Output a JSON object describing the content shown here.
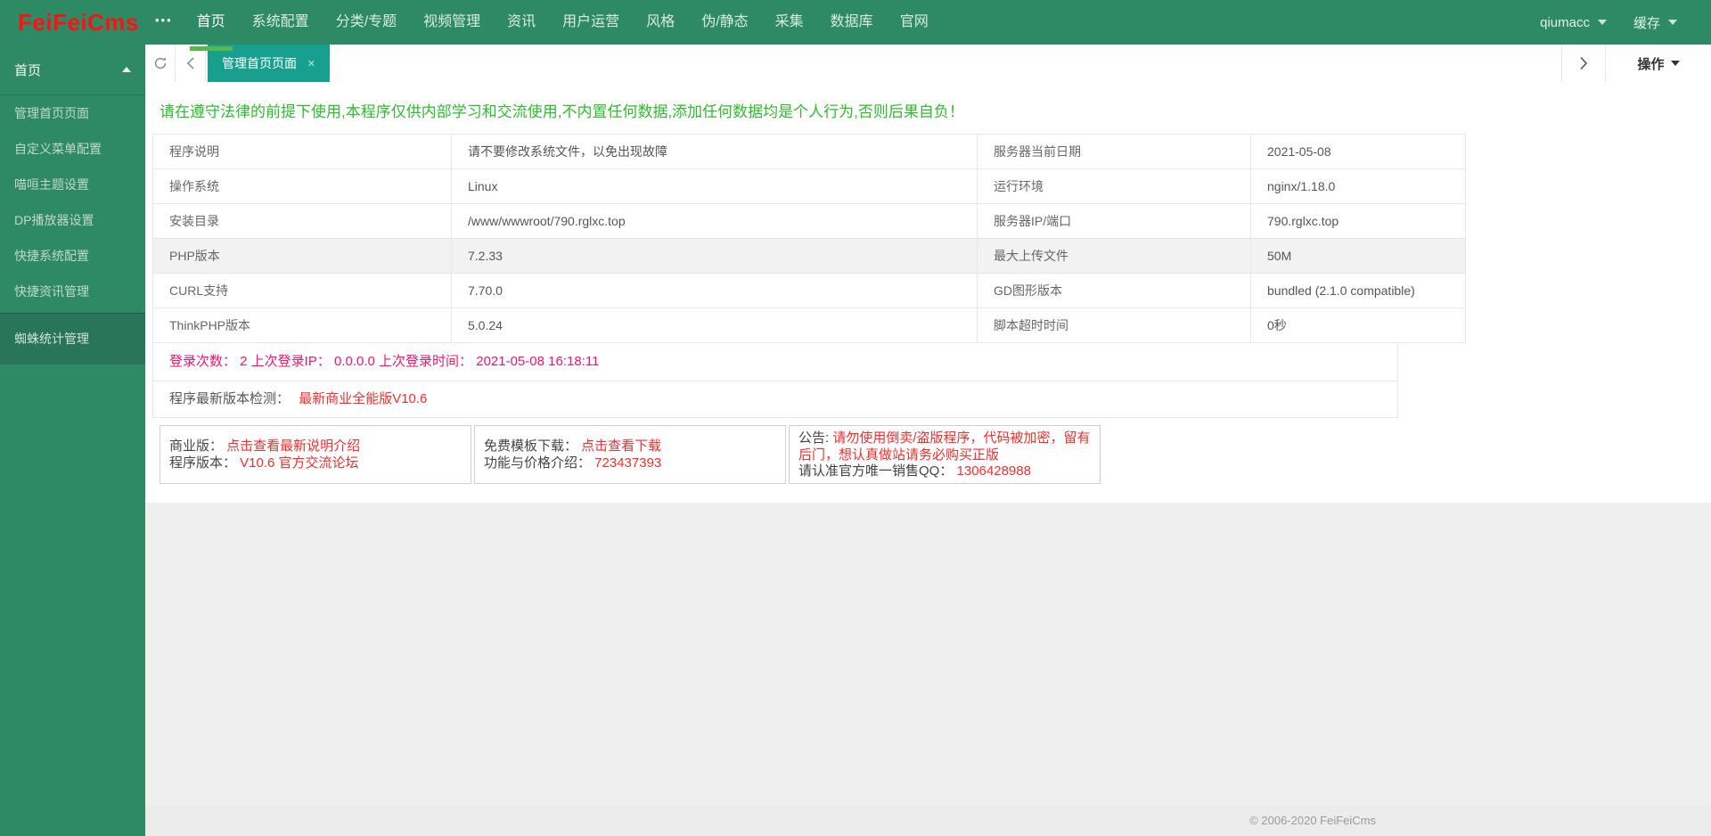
{
  "brand": {
    "logo": "FeiFeiCms",
    "more_icon": "•••"
  },
  "topnav": {
    "items": [
      {
        "id": "home",
        "label": "首页",
        "active": true
      },
      {
        "id": "system-config",
        "label": "系统配置"
      },
      {
        "id": "category-topic",
        "label": "分类/专题"
      },
      {
        "id": "video-management",
        "label": "视频管理"
      },
      {
        "id": "news",
        "label": "资讯"
      },
      {
        "id": "user-operation",
        "label": "用户运营"
      },
      {
        "id": "style",
        "label": "风格"
      },
      {
        "id": "pseudo-static",
        "label": "伪/静态"
      },
      {
        "id": "collect",
        "label": "采集"
      },
      {
        "id": "database",
        "label": "数据库"
      },
      {
        "id": "official-site",
        "label": "官网"
      }
    ],
    "user": "qiumacc",
    "cache": "缓存"
  },
  "sidebar": {
    "group_title": "首页",
    "items": [
      {
        "id": "manage-homepage",
        "label": "管理首页页面"
      },
      {
        "id": "custom-menu-config",
        "label": "自定义菜单配置"
      },
      {
        "id": "miaoxuan-theme-settings",
        "label": "喵咺主题设置"
      },
      {
        "id": "dp-player-settings",
        "label": "DP播放器设置"
      },
      {
        "id": "quick-system-config",
        "label": "快捷系统配置"
      },
      {
        "id": "quick-news-management",
        "label": "快捷资讯管理"
      }
    ],
    "bottom_group": "蜘蛛统计管理"
  },
  "tabbar": {
    "active_tab": "管理首页页面",
    "close": "×",
    "action_label": "操作"
  },
  "main": {
    "warning": "请在遵守法律的前提下使用,本程序仅供内部学习和交流使用,不内置任何数据,添加任何数据均是个人行为,否则后果自负！",
    "info_rows": [
      {
        "l1": "程序说明",
        "v1": "请不要修改系统文件，以免出现故障",
        "l2": "服务器当前日期",
        "v2": "2021-05-08",
        "highlight": false
      },
      {
        "l1": "操作系统",
        "v1": "Linux",
        "l2": "运行环境",
        "v2": "nginx/1.18.0",
        "highlight": false
      },
      {
        "l1": "安装目录",
        "v1": "/www/wwwroot/790.rglxc.top",
        "l2": "服务器IP/端口",
        "v2": "790.rglxc.top",
        "highlight": false
      },
      {
        "l1": "PHP版本",
        "v1": "7.2.33",
        "l2": "最大上传文件",
        "v2": "50M",
        "highlight": true
      },
      {
        "l1": "CURL支持",
        "v1": "7.70.0",
        "l2": "GD图形版本",
        "v2": "bundled (2.1.0 compatible)",
        "highlight": false
      },
      {
        "l1": "ThinkPHP版本",
        "v1": "5.0.24",
        "l2": "脚本超时时间",
        "v2": "0秒",
        "highlight": false
      }
    ],
    "login_info": "登录次数： 2 上次登录IP： 0.0.0.0 上次登录时间： 2021-05-08 16:18:11",
    "version_check_label": "程序最新版本检测：",
    "version_check_link": "最新商业全能版V10.6",
    "boxes": [
      {
        "lines": [
          [
            {
              "text": "商业版： ",
              "red": false
            },
            {
              "text": "点击查看最新说明介绍",
              "red": true
            }
          ],
          [
            {
              "text": "程序版本： ",
              "red": false
            },
            {
              "text": "V10.6 官方交流论坛",
              "red": true
            }
          ]
        ]
      },
      {
        "lines": [
          [
            {
              "text": "免费模板下载： ",
              "red": false
            },
            {
              "text": "点击查看下载",
              "red": true
            }
          ],
          [
            {
              "text": "功能与价格介绍： ",
              "red": false
            },
            {
              "text": "723437393",
              "red": true
            }
          ]
        ]
      },
      {
        "lines": [
          [
            {
              "text": "公告: ",
              "red": false
            },
            {
              "text": "请勿使用倒卖/盗版程序，代码被加密，留有后门，想认真做站请务必购买正版",
              "red": true
            }
          ],
          [
            {
              "text": "请认准官方唯一销售QQ： ",
              "red": false
            },
            {
              "text": "1306428988",
              "red": true
            }
          ]
        ]
      }
    ]
  },
  "footer": "© 2006-2020 FeiFeiCms",
  "colors": {
    "navbar_green": "#2e8a65",
    "sidebar_bottom_green": "#28755a",
    "tab_teal": "#17a08e",
    "indicator_green": "#54b948",
    "warning_green": "#2dbd2d",
    "login_pink": "#f4156f",
    "link_red": "#f62d2d",
    "logo_red": "#fe1111",
    "highlight_row_gray": "#f2f2f2"
  }
}
